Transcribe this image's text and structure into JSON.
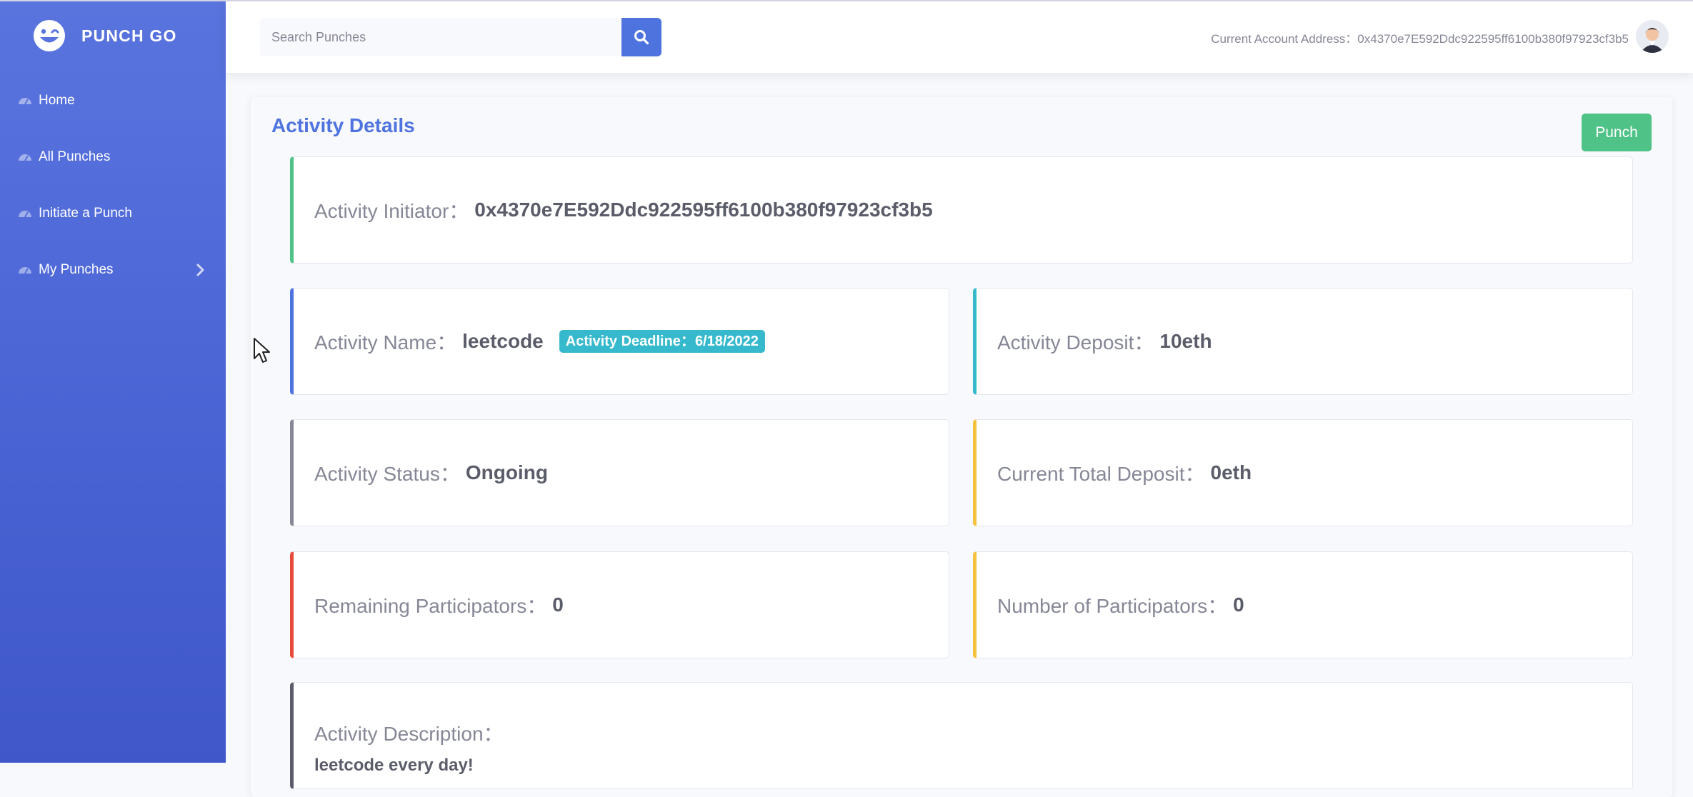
{
  "app": {
    "brand": "PUNCH GO"
  },
  "sidebar": {
    "items": [
      {
        "label": "Home",
        "icon": "dashboard-gauge-icon"
      },
      {
        "label": "All Punches",
        "icon": "dashboard-gauge-icon"
      },
      {
        "label": "Initiate a Punch",
        "icon": "dashboard-gauge-icon"
      },
      {
        "label": "My Punches",
        "icon": "dashboard-gauge-icon",
        "expandable": true
      }
    ]
  },
  "topbar": {
    "search": {
      "placeholder": "Search Punches",
      "value": ""
    },
    "account_label": "Current Account Address：",
    "account_address": "0x4370e7E592Ddc922595ff6100b380f97923cf3b5"
  },
  "details": {
    "title": "Activity Details",
    "punch_button": "Punch",
    "initiator_label": "Activity Initiator：",
    "initiator_value": "0x4370e7E592Ddc922595ff6100b380f97923cf3b5",
    "name_label": "Activity Name：",
    "name_value": "leetcode",
    "deadline_label": "Activity Deadline：",
    "deadline_value": "6/18/2022",
    "deposit_label": "Activity Deposit：",
    "deposit_value": "10eth",
    "status_label": "Activity Status：",
    "status_value": "Ongoing",
    "total_deposit_label": "Current Total Deposit：",
    "total_deposit_value": "0eth",
    "remaining_label": "Remaining Participators：",
    "remaining_value": "0",
    "participators_label": "Number of Participators：",
    "participators_value": "0",
    "description_label": "Activity Description：",
    "description_value": "leetcode every day!"
  },
  "colors": {
    "primary": "#4e73df",
    "success": "#4fc387",
    "info": "#36b9cc",
    "warning": "#f6c23e",
    "danger": "#e74a3b",
    "secondary": "#858796",
    "dark": "#5a5c69"
  }
}
